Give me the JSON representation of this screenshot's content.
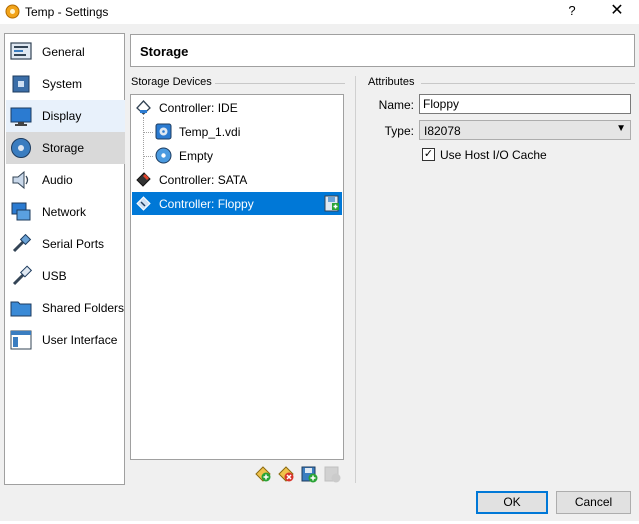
{
  "window": {
    "title": "Temp - Settings",
    "help_label": "?",
    "close_label": "✕"
  },
  "nav": {
    "items": [
      {
        "label": "General",
        "icon": "general-icon"
      },
      {
        "label": "System",
        "icon": "system-chip-icon"
      },
      {
        "label": "Display",
        "icon": "display-monitor-icon"
      },
      {
        "label": "Storage",
        "icon": "storage-disk-icon"
      },
      {
        "label": "Audio",
        "icon": "speaker-icon"
      },
      {
        "label": "Network",
        "icon": "network-icon"
      },
      {
        "label": "Serial Ports",
        "icon": "serial-port-icon"
      },
      {
        "label": "USB",
        "icon": "usb-icon"
      },
      {
        "label": "Shared Folders",
        "icon": "folder-icon"
      },
      {
        "label": "User Interface",
        "icon": "user-interface-icon"
      }
    ],
    "selected": "Storage",
    "hovered": "Display"
  },
  "header": {
    "title": "Storage"
  },
  "storage_devices": {
    "title": "Storage Devices",
    "tree": [
      {
        "label": "Controller: IDE",
        "icon": "ide-controller-icon"
      },
      {
        "label": "Temp_1.vdi",
        "icon": "hard-disk-icon"
      },
      {
        "label": "Empty",
        "icon": "optical-disc-icon"
      },
      {
        "label": "Controller: SATA",
        "icon": "sata-controller-icon"
      },
      {
        "label": "Controller: Floppy",
        "icon": "floppy-controller-icon"
      }
    ],
    "toolbar_icons": [
      "add-controller-icon",
      "remove-controller-icon",
      "add-attachment-icon",
      "remove-attachment-icon"
    ]
  },
  "attributes": {
    "title": "Attributes",
    "name_label": "Name:",
    "name_value": "Floppy",
    "type_label": "Type:",
    "type_value": "I82078",
    "cache_label": "Use Host I/O Cache",
    "cache_checked": true,
    "check_mark": "✓"
  },
  "buttons": {
    "ok": "OK",
    "cancel": "Cancel"
  },
  "colors": {
    "selection": "#0078d7",
    "nav_selected": "#d9d9d9"
  }
}
